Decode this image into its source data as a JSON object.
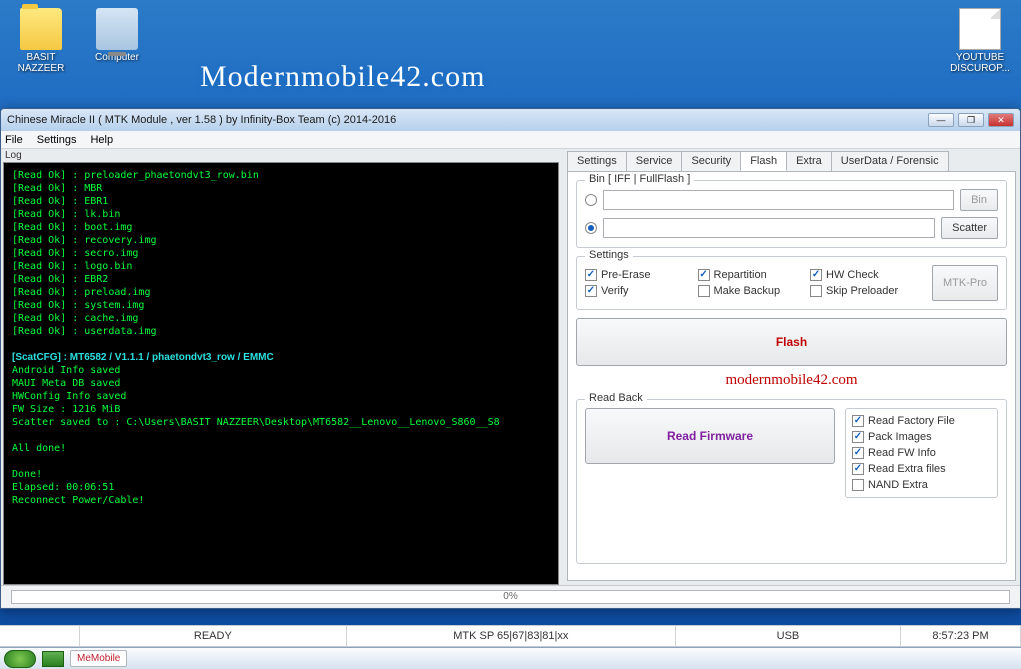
{
  "desktop": {
    "icons": [
      {
        "name": "BASIT NAZZEER",
        "type": "folder"
      },
      {
        "name": "Computer",
        "type": "computer"
      },
      {
        "name": "YOUTUBE DISCUROP...",
        "type": "doc"
      }
    ]
  },
  "watermark": "Modernmobile42.com",
  "window": {
    "title": "Chinese Miracle II ( MTK Module , ver 1.58 ) by Infinity-Box Team (c) 2014-2016",
    "menu": [
      "File",
      "Settings",
      "Help"
    ],
    "log_label": "Log",
    "log_lines": "[Read Ok] : preloader_phaetondvt3_row.bin\n[Read Ok] : MBR\n[Read Ok] : EBR1\n[Read Ok] : lk.bin\n[Read Ok] : boot.img\n[Read Ok] : recovery.img\n[Read Ok] : secro.img\n[Read Ok] : logo.bin\n[Read Ok] : EBR2\n[Read Ok] : preload.img\n[Read Ok] : system.img\n[Read Ok] : cache.img\n[Read Ok] : userdata.img\n\n<span class=\"cyan\">[ScatCFG] : MT6582 / V1.1.1 / phaetondvt3_row / EMMC</span>\nAndroid Info saved\nMAUI Meta DB saved\nHWConfig Info saved\nFW Size : 1216 MiB\nScatter saved to : C:\\Users\\BASIT NAZZEER\\Desktop\\MT6582__Lenovo__Lenovo_S860__S8\n\nAll done!\n\nDone!\nElapsed: 00:06:51\nReconnect Power/Cable!",
    "tabs": [
      "Settings",
      "Service",
      "Security",
      "Flash",
      "Extra",
      "UserData / Forensic"
    ],
    "active_tab": "Flash",
    "bin_group": {
      "title": "Bin  [ IFF | FullFlash ]",
      "bin_btn": "Bin",
      "scatter_btn": "Scatter"
    },
    "settings_group": {
      "title": "Settings",
      "items": [
        {
          "label": "Pre-Erase",
          "checked": true
        },
        {
          "label": "Repartition",
          "checked": true
        },
        {
          "label": "HW Check",
          "checked": true
        },
        {
          "label": "Verify",
          "checked": true
        },
        {
          "label": "Make Backup",
          "checked": false
        },
        {
          "label": "Skip Preloader",
          "checked": false
        }
      ],
      "mtk_pro": "MTK-Pro"
    },
    "flash_btn": "Flash",
    "link_text": "modernmobile42.com",
    "readback": {
      "title": "Read Back",
      "read_fw": "Read Firmware",
      "items": [
        {
          "label": "Read Factory File",
          "checked": true
        },
        {
          "label": "Pack Images",
          "checked": true
        },
        {
          "label": "Read FW Info",
          "checked": true
        },
        {
          "label": "Read Extra files",
          "checked": true
        },
        {
          "label": "NAND Extra",
          "checked": false
        }
      ]
    },
    "progress": "0%"
  },
  "statusbar": {
    "cells": [
      "READY",
      "MTK SP 65|67|83|81|xx",
      "USB",
      "8:57:23 PM"
    ]
  },
  "taskbar": {
    "item": "MeMobile"
  }
}
